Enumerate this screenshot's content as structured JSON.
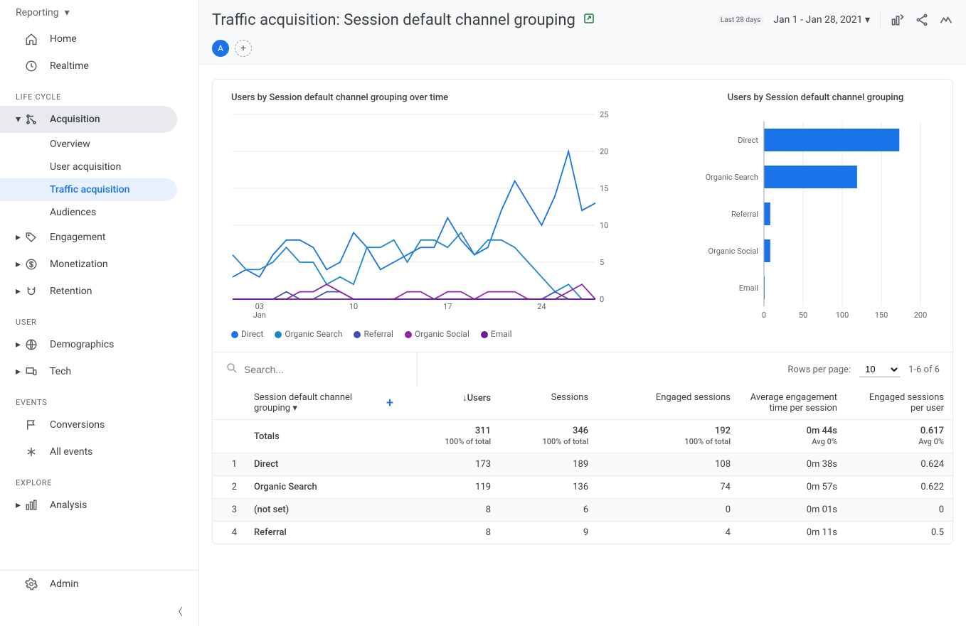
{
  "sidebar": {
    "top_label": "Reporting",
    "items_top": [
      {
        "icon": "home",
        "label": "Home"
      },
      {
        "icon": "clock",
        "label": "Realtime"
      }
    ],
    "sections": [
      {
        "label": "LIFE CYCLE",
        "items": [
          {
            "icon": "acq",
            "label": "Acquisition",
            "expanded": true,
            "children": [
              {
                "label": "Overview"
              },
              {
                "label": "User acquisition"
              },
              {
                "label": "Traffic acquisition",
                "active": true
              },
              {
                "label": "Audiences"
              }
            ]
          },
          {
            "icon": "tag",
            "label": "Engagement"
          },
          {
            "icon": "dollar",
            "label": "Monetization"
          },
          {
            "icon": "magnet",
            "label": "Retention"
          }
        ]
      },
      {
        "label": "USER",
        "items": [
          {
            "icon": "globe",
            "label": "Demographics"
          },
          {
            "icon": "device",
            "label": "Tech"
          }
        ]
      },
      {
        "label": "EVENTS",
        "items": [
          {
            "icon": "flag",
            "label": "Conversions",
            "no_arrow": true
          },
          {
            "icon": "asterisk",
            "label": "All events",
            "no_arrow": true
          }
        ]
      },
      {
        "label": "EXPLORE",
        "items": [
          {
            "icon": "chart",
            "label": "Analysis"
          }
        ]
      }
    ],
    "admin_label": "Admin"
  },
  "header": {
    "title": "Traffic acquisition: Session default channel grouping",
    "date_preset": "Last 28 days",
    "date_range": "Jan 1 - Jan 28, 2021",
    "compare_chip": "A"
  },
  "chart_data": [
    {
      "type": "line",
      "title": "Users by Session default channel grouping over time",
      "xlabel": "",
      "ylabel": "",
      "ylim": [
        0,
        25
      ],
      "x_ticks": [
        "03",
        "10",
        "17",
        "24"
      ],
      "x_sublabel": "Jan",
      "y_ticks": [
        0,
        5,
        10,
        15,
        20,
        25
      ],
      "series": [
        {
          "name": "Direct",
          "color": "#1a73e8",
          "values": [
            3,
            4,
            3,
            6,
            8,
            8,
            7,
            4,
            5,
            9,
            7,
            4,
            5,
            6,
            7,
            7,
            11,
            8,
            6,
            7,
            12,
            16,
            13,
            10,
            14,
            20,
            12,
            13
          ]
        },
        {
          "name": "Organic Search",
          "color": "#1e88c7",
          "values": [
            6,
            4,
            4,
            5,
            7,
            5,
            5,
            2,
            3,
            2,
            7,
            7,
            8,
            5,
            8,
            8,
            7,
            9,
            6,
            8,
            8,
            7,
            5,
            3,
            1,
            2,
            0,
            0
          ]
        },
        {
          "name": "Referral",
          "color": "#3f51b5",
          "values": [
            0,
            0,
            0,
            0,
            1,
            0,
            0,
            1,
            1,
            0,
            0,
            0,
            0,
            0,
            0,
            0,
            0,
            0,
            0,
            0,
            0,
            0,
            0,
            0,
            1,
            0,
            0,
            0
          ]
        },
        {
          "name": "Organic Social",
          "color": "#8e24aa",
          "values": [
            0,
            0,
            0,
            0,
            0,
            1,
            1,
            2,
            1,
            0,
            0,
            0,
            0,
            1,
            1,
            0,
            1,
            1,
            0,
            1,
            1,
            1,
            0,
            0,
            0,
            1,
            2,
            0
          ]
        },
        {
          "name": "Email",
          "color": "#6a1b9a",
          "values": [
            0,
            0,
            0,
            0,
            0,
            0,
            0,
            0,
            0,
            0,
            0,
            0,
            0,
            0,
            0,
            0,
            0,
            0,
            0,
            0,
            0,
            0,
            0,
            0,
            0,
            0,
            0,
            0
          ]
        }
      ]
    },
    {
      "type": "bar",
      "title": "Users by Session default channel grouping",
      "orientation": "horizontal",
      "xlim": [
        0,
        200
      ],
      "x_ticks": [
        0,
        50,
        100,
        150,
        200
      ],
      "categories": [
        "Direct",
        "Organic Search",
        "Referral",
        "Organic Social",
        "Email"
      ],
      "values": [
        173,
        119,
        8,
        8,
        0
      ],
      "color": "#1a73e8"
    }
  ],
  "table": {
    "search_placeholder": "Search...",
    "rows_per_page_label": "Rows per page:",
    "rows_per_page_value": "10",
    "pagination_label": "1-6 of 6",
    "dimension_header": "Session default channel grouping",
    "columns": [
      {
        "label": "Users",
        "sorted_desc": true
      },
      {
        "label": "Sessions"
      },
      {
        "label": "Engaged sessions"
      },
      {
        "label": "Average engagement time per session"
      },
      {
        "label": "Engaged sessions per user"
      }
    ],
    "totals_label": "Totals",
    "totals": {
      "users": {
        "v": "311",
        "sub": "100% of total"
      },
      "sessions": {
        "v": "346",
        "sub": "100% of total"
      },
      "engaged": {
        "v": "192",
        "sub": "100% of total"
      },
      "avg_time": {
        "v": "0m 44s",
        "sub": "Avg 0%"
      },
      "eng_per_user": {
        "v": "0.617",
        "sub": "Avg 0%"
      }
    },
    "rows": [
      {
        "n": 1,
        "dim": "Direct",
        "users": "173",
        "sessions": "189",
        "engaged": "108",
        "avg_time": "0m 38s",
        "eng_per_user": "0.624"
      },
      {
        "n": 2,
        "dim": "Organic Search",
        "users": "119",
        "sessions": "136",
        "engaged": "74",
        "avg_time": "0m 57s",
        "eng_per_user": "0.622"
      },
      {
        "n": 3,
        "dim": "(not set)",
        "users": "8",
        "sessions": "6",
        "engaged": "0",
        "avg_time": "0m 01s",
        "eng_per_user": "0"
      },
      {
        "n": 4,
        "dim": "Referral",
        "users": "8",
        "sessions": "9",
        "engaged": "4",
        "avg_time": "0m 11s",
        "eng_per_user": "0.5"
      }
    ]
  }
}
